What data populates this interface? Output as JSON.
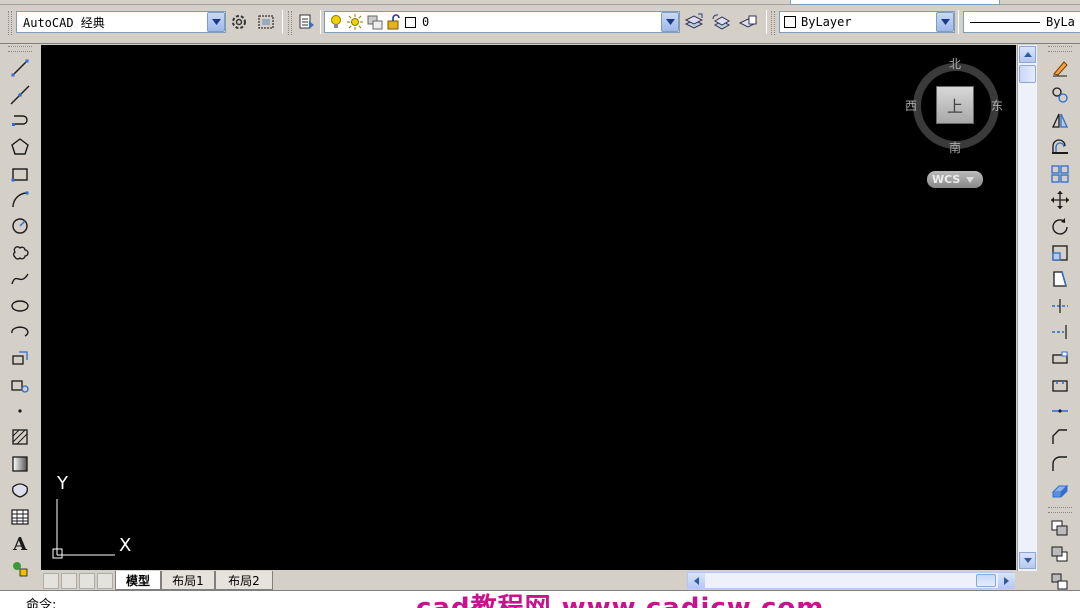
{
  "workspace": {
    "value": "AutoCAD 经典"
  },
  "layer": {
    "current": "0"
  },
  "color": {
    "value": "ByLayer"
  },
  "linetype": {
    "value": "ByLa"
  },
  "viewcube": {
    "north": "北",
    "south": "南",
    "east": "东",
    "west": "西",
    "face": "上",
    "wcs": "WCS"
  },
  "ucs": {
    "y_label": "Y",
    "x_label": "X"
  },
  "tabs": [
    {
      "label": "模型"
    },
    {
      "label": "布局1"
    },
    {
      "label": "布局2"
    }
  ],
  "command": {
    "prompt": "命令:"
  },
  "watermark": {
    "text": "cad教程网 www.cadjcw.com"
  },
  "colors": {
    "canvas": "#000000",
    "toolbar": "#d4d0c8",
    "watermark": "#c8148c",
    "combo_border": "#7f9db9"
  },
  "left_tools": [
    "line-icon",
    "construction-line-icon",
    "polyline-icon",
    "polygon-icon",
    "rectangle-icon",
    "arc-icon",
    "circle-icon",
    "revision-cloud-icon",
    "spline-icon",
    "ellipse-icon",
    "ellipse-arc-icon",
    "insert-block-icon",
    "make-block-icon",
    "point-icon",
    "hatch-icon",
    "gradient-icon",
    "region-icon",
    "table-icon",
    "multiline-text-icon",
    "add-selected-icon"
  ],
  "right_tools": [
    "erase-icon",
    "copy-icon",
    "mirror-icon",
    "offset-icon",
    "array-icon",
    "move-icon",
    "rotate-icon",
    "scale-icon",
    "stretch-icon",
    "trim-icon",
    "extend-icon",
    "break-at-point-icon",
    "break-icon",
    "join-icon",
    "chamfer-icon",
    "fillet-icon",
    "explode-icon"
  ],
  "draw_order_tools": [
    "bring-front-icon",
    "send-back-icon",
    "bring-above-icon"
  ]
}
